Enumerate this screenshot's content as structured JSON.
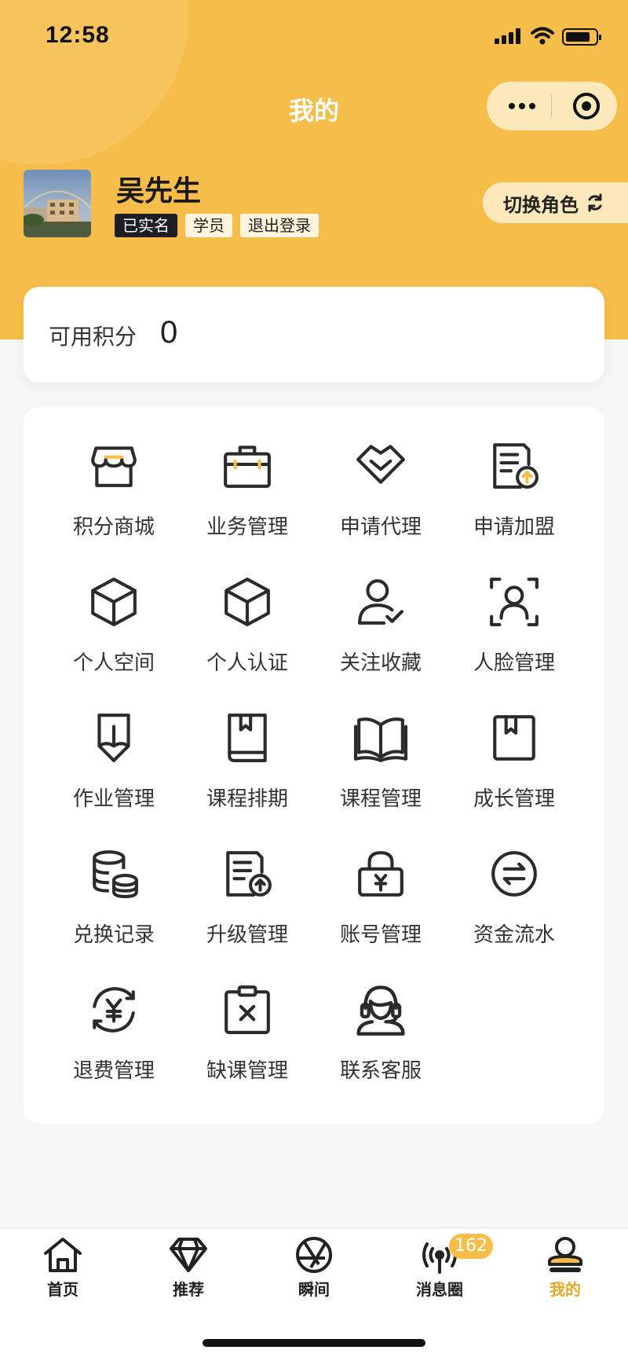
{
  "status_bar": {
    "time": "12:58"
  },
  "header": {
    "title": "我的"
  },
  "colors": {
    "brand": "#f6bd4a",
    "accent_text": "#e8a727",
    "tag_dark": "#1d1d26"
  },
  "profile": {
    "name": "吴先生",
    "tags": [
      "已实名",
      "学员",
      "退出登录"
    ],
    "switch_role": "切换角色"
  },
  "points": {
    "label": "可用积分",
    "value": "0"
  },
  "menu": {
    "items": [
      {
        "label": "积分商城",
        "icon": "shop-icon"
      },
      {
        "label": "业务管理",
        "icon": "briefcase-icon"
      },
      {
        "label": "申请代理",
        "icon": "diamond-heart-icon"
      },
      {
        "label": "申请加盟",
        "icon": "document-upload-icon"
      },
      {
        "label": "个人空间",
        "icon": "cube-icon"
      },
      {
        "label": "个人认证",
        "icon": "cube-icon"
      },
      {
        "label": "关注收藏",
        "icon": "user-check-icon"
      },
      {
        "label": "人脸管理",
        "icon": "face-scan-icon"
      },
      {
        "label": "作业管理",
        "icon": "pencil-icon"
      },
      {
        "label": "课程排期",
        "icon": "book-bookmark-icon"
      },
      {
        "label": "课程管理",
        "icon": "open-book-icon"
      },
      {
        "label": "成长管理",
        "icon": "bookmark-box-icon"
      },
      {
        "label": "兑换记录",
        "icon": "coins-stack-icon"
      },
      {
        "label": "升级管理",
        "icon": "document-upload-icon"
      },
      {
        "label": "账号管理",
        "icon": "lock-yuan-icon"
      },
      {
        "label": "资金流水",
        "icon": "exchange-circle-icon"
      },
      {
        "label": "退费管理",
        "icon": "refund-yuan-icon"
      },
      {
        "label": "缺课管理",
        "icon": "clipboard-x-icon"
      },
      {
        "label": "联系客服",
        "icon": "customer-service-icon"
      }
    ]
  },
  "tabbar": {
    "tabs": [
      {
        "label": "首页",
        "icon": "home-icon"
      },
      {
        "label": "推荐",
        "icon": "diamond-icon"
      },
      {
        "label": "瞬间",
        "icon": "aperture-icon"
      },
      {
        "label": "消息圈",
        "icon": "broadcast-icon"
      },
      {
        "label": "我的",
        "icon": "user-icon"
      }
    ],
    "badge": "162",
    "active_index": 4
  }
}
